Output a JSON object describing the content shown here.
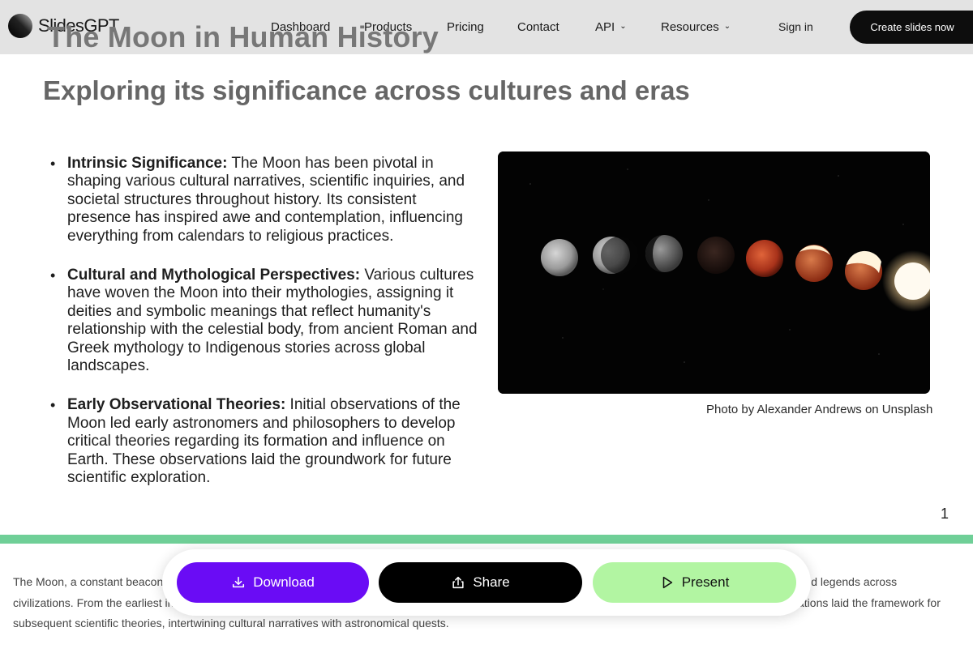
{
  "app": {
    "name": "SlidesGPT",
    "logo_icon": "slidesgpt-logo-icon"
  },
  "nav": {
    "links": [
      {
        "label": "Dashboard",
        "dropdown": false
      },
      {
        "label": "Products",
        "dropdown": false
      },
      {
        "label": "Pricing",
        "dropdown": false
      },
      {
        "label": "Contact",
        "dropdown": false
      },
      {
        "label": "API",
        "dropdown": true,
        "icon": "chevron-down-icon"
      },
      {
        "label": "Resources",
        "dropdown": true,
        "icon": "chevron-down-icon"
      }
    ],
    "signin_label": "Sign in",
    "cta_label": "Create slides now"
  },
  "slide": {
    "title": "The Moon in Human History",
    "subtitle": "Exploring its significance across cultures and eras",
    "bullets": [
      {
        "heading": "Intrinsic Significance:",
        "text": "The Moon has been pivotal in shaping various cultural narratives, scientific inquiries, and societal structures throughout history. Its consistent presence has inspired awe and contemplation, influencing everything from calendars to religious practices."
      },
      {
        "heading": "Cultural and Mythological Perspectives:",
        "text": "Various cultures have woven the Moon into their mythologies, assigning it deities and symbolic meanings that reflect humanity's relationship with the celestial body, from ancient Roman and Greek mythology to Indigenous stories across global landscapes."
      },
      {
        "heading": "Early Observational Theories:",
        "text": "Initial observations of the Moon led early astronomers and philosophers to develop critical theories regarding its formation and influence on Earth. These observations laid the groundwork for future scientific exploration."
      }
    ],
    "photo_credit": "Photo by Alexander Andrews on Unsplash",
    "page_number": "1"
  },
  "notes": {
    "text": "The Moon, a constant beacon in the night sky, has served as a source of wonder and inspiration, guiding cultures, influencing calendars, and shaping myths and legends across civilizations. From the earliest inquiries by ancient thinkers, the Moon has consistently beckoned humanity towards understanding its mysteries. Early observations laid the framework for subsequent scientific theories, intertwining cultural narratives with astronomical quests."
  },
  "actions": {
    "download_label": "Download",
    "download_icon": "download-icon",
    "share_label": "Share",
    "share_icon": "share-icon",
    "present_label": "Present",
    "present_icon": "play-icon"
  },
  "colors": {
    "download": "#6a0cf5",
    "share": "#000000",
    "present": "#b2f5a2",
    "divider": "#6fcf97",
    "navbar": "#e3e3e3"
  }
}
